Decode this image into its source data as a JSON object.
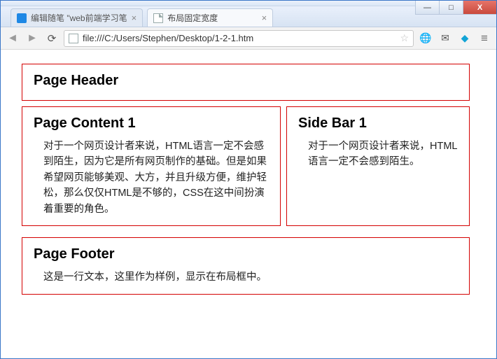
{
  "window": {
    "minimize": "—",
    "maximize": "□",
    "close": "X"
  },
  "tabs": [
    {
      "title": "编辑随笔 \"web前端学习笔",
      "active": false,
      "favicon": "blue"
    },
    {
      "title": "布局固定宽度",
      "active": true,
      "favicon": "page"
    }
  ],
  "toolbar": {
    "url": "file:///C:/Users/Stephen/Desktop/1-2-1.htm"
  },
  "page": {
    "header": {
      "title": "Page Header"
    },
    "content1": {
      "title": "Page Content 1",
      "body": "对于一个网页设计者来说，HTML语言一定不会感到陌生，因为它是所有网页制作的基础。但是如果希望网页能够美观、大方，并且升级方便，维护轻松，那么仅仅HTML是不够的，CSS在这中间扮演着重要的角色。"
    },
    "sidebar1": {
      "title": "Side Bar 1",
      "body": "对于一个网页设计者来说，HTML语言一定不会感到陌生。"
    },
    "footer": {
      "title": "Page Footer",
      "body": "这是一行文本，这里作为样例，显示在布局框中。"
    }
  }
}
